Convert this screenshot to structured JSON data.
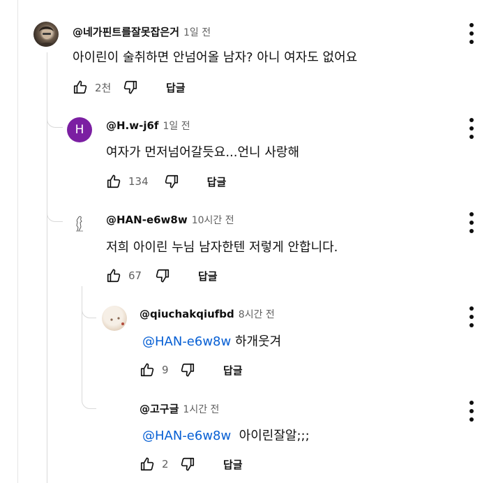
{
  "comments": [
    {
      "author": "@네가핀트를잘못잡은거",
      "time": "1일 전",
      "text": "아이린이 술취하면 안넘어올 남자? 아니 여자도 없어요",
      "likes": "2천",
      "reply_label": "답글",
      "avatar_icon": "user-photo"
    },
    {
      "author": "@H.w-j6f",
      "time": "1일 전",
      "text": "여자가 먼저넘어갈듯요...언니 사랑해",
      "likes": "134",
      "reply_label": "답글",
      "avatar_letter": "H",
      "avatar_color": "#7b1fa2"
    },
    {
      "author": "@HAN-e6w8w",
      "time": "10시간 전",
      "text": "저희 아이린 누님 남자한텐 저렇게 안합니다.",
      "likes": "67",
      "reply_label": "답글",
      "avatar_icon": "sketch-figure"
    },
    {
      "author": "@qiuchakqiufbd",
      "time": "8시간 전",
      "mention": "@HAN-e6w8w",
      "text": " 하개웃겨",
      "likes": "9",
      "reply_label": "답글",
      "avatar_icon": "cat-photo"
    },
    {
      "author": "@고구글",
      "time": "1시간 전",
      "mention": "@HAN-e6w8w",
      "text": "  아이린잘알;;;",
      "likes": "2",
      "reply_label": "답글"
    }
  ],
  "icons": {
    "like": "thumb-up-icon",
    "dislike": "thumb-down-icon",
    "menu": "more-vert-icon"
  }
}
